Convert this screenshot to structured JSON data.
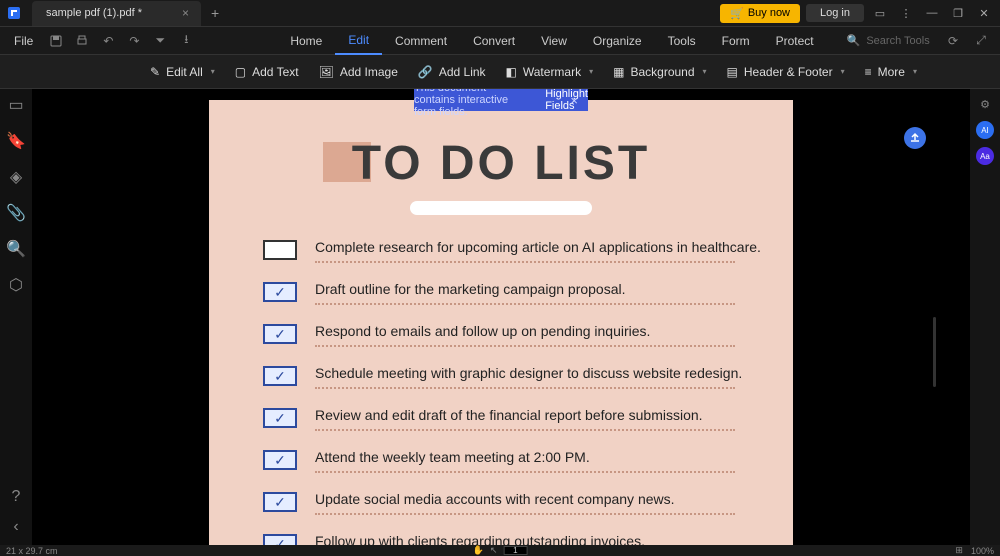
{
  "tab": {
    "name": "sample pdf (1).pdf *"
  },
  "titlebar": {
    "buy": "Buy now",
    "login": "Log in"
  },
  "menubar": {
    "file": "File",
    "items": [
      "Home",
      "Edit",
      "Comment",
      "Convert",
      "View",
      "Organize",
      "Tools",
      "Form",
      "Protect"
    ],
    "active_index": 1,
    "search_placeholder": "Search Tools"
  },
  "toolbar": {
    "edit_all": "Edit All",
    "add_text": "Add Text",
    "add_image": "Add Image",
    "add_link": "Add Link",
    "watermark": "Watermark",
    "background": "Background",
    "header_footer": "Header & Footer",
    "more": "More"
  },
  "banner": {
    "message": "This document contains interactive form fields.",
    "link": "Highlight Fields"
  },
  "document": {
    "title": "TO DO LIST",
    "items": [
      {
        "checked": false,
        "text": "Complete research for upcoming article on AI applications in healthcare."
      },
      {
        "checked": true,
        "text": "Draft outline for the marketing campaign proposal."
      },
      {
        "checked": true,
        "text": "Respond to emails and follow up on pending inquiries."
      },
      {
        "checked": true,
        "text": "Schedule meeting with graphic designer to discuss website redesign."
      },
      {
        "checked": true,
        "text": "Review and edit draft of the financial report before submission."
      },
      {
        "checked": true,
        "text": "Attend the weekly team meeting at 2:00 PM."
      },
      {
        "checked": true,
        "text": "Update social media accounts with recent company news."
      },
      {
        "checked": true,
        "text": "Follow up with clients regarding outstanding invoices."
      }
    ]
  },
  "status": {
    "dimensions": "21 x 29.7 cm",
    "page": "1",
    "zoom": "100%"
  }
}
